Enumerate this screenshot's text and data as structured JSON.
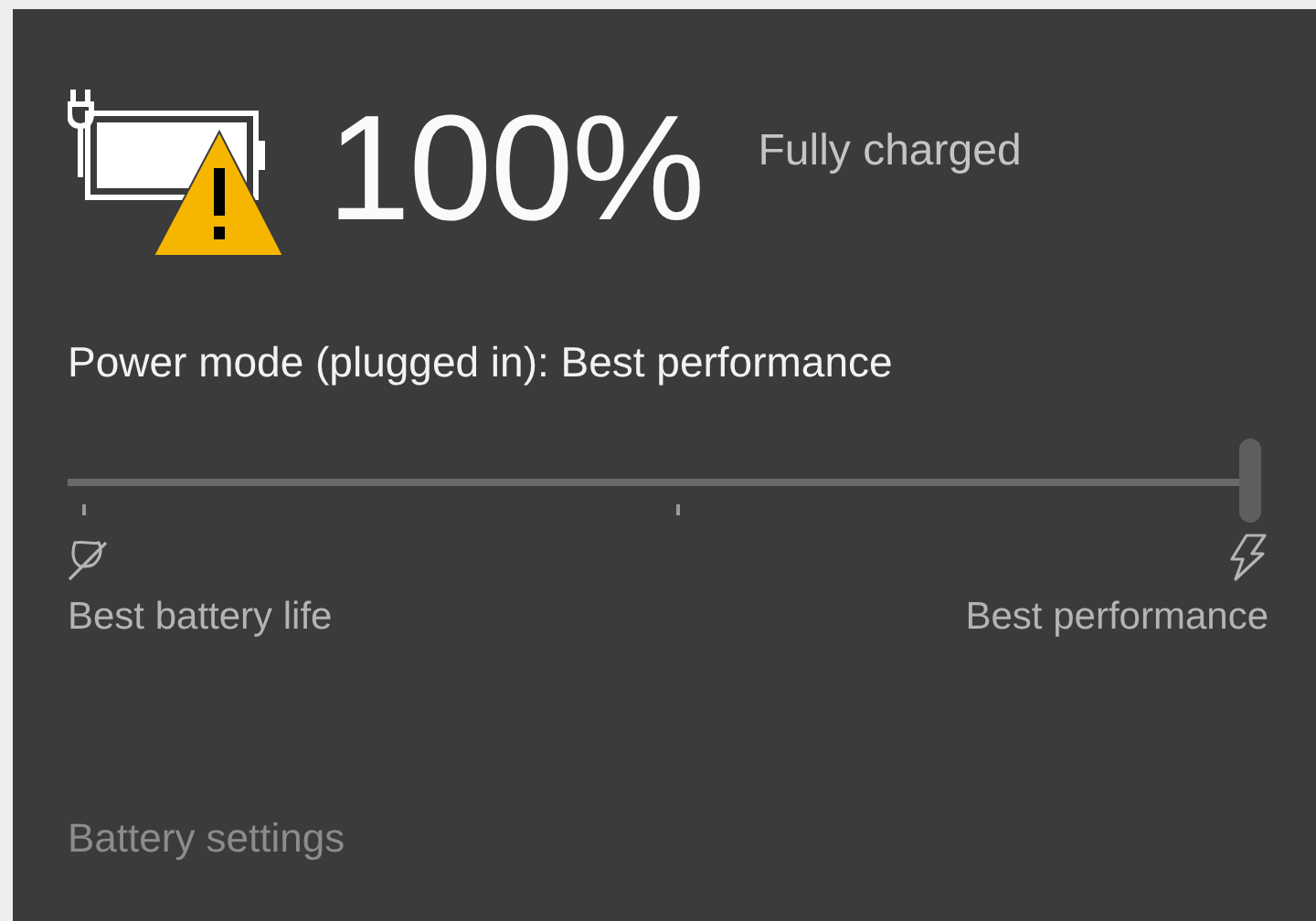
{
  "battery": {
    "percent": "100%",
    "status": "Fully charged",
    "plugged_in": true,
    "warning": true
  },
  "power_mode": {
    "label": "Power mode (plugged in): Best performance",
    "level": 1,
    "min_label": "Best battery life",
    "max_label": "Best performance"
  },
  "settings_link": "Battery settings"
}
